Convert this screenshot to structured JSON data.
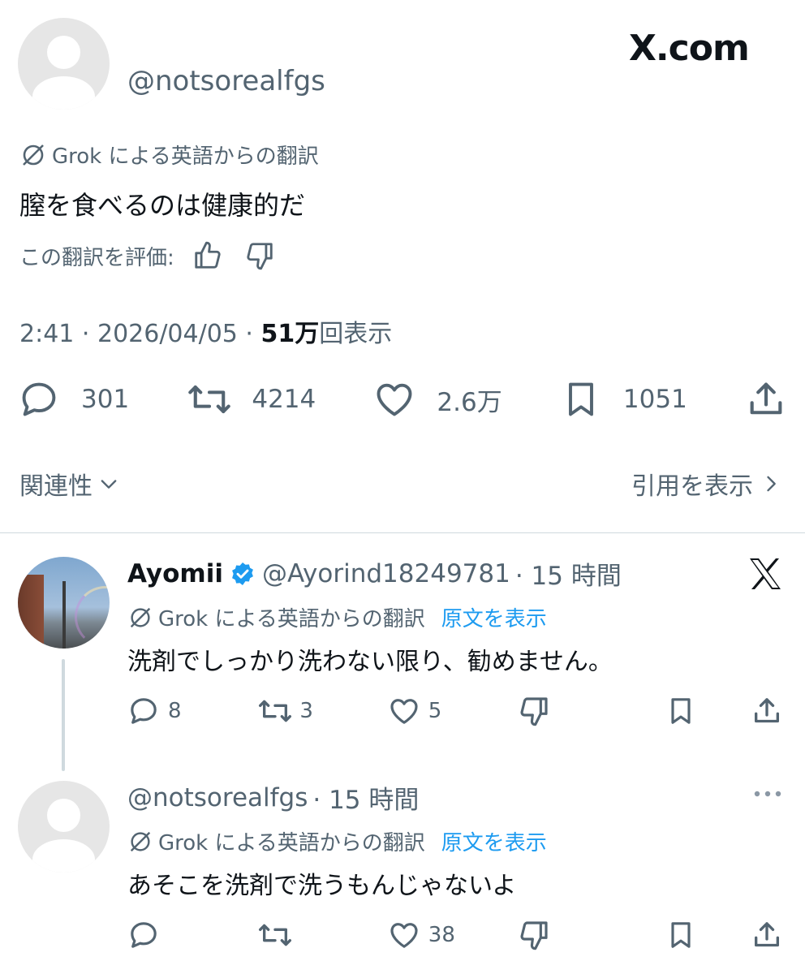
{
  "brand": {
    "logo_text": "X.com"
  },
  "main_post": {
    "handle": "@notsorealfgs",
    "translation_label": "Grok による英語からの翻訳",
    "text": "膣を食べるのは健康的だ",
    "rate_label": "この翻訳を評価:",
    "time": "2:41 · 2026/04/05 · ",
    "views_number": "51万",
    "views_suffix": "回表示",
    "metrics": {
      "replies": "301",
      "reposts": "4214",
      "likes": "2.6万",
      "bookmarks": "1051"
    },
    "sort_label": "関連性",
    "quotes_label": "引用を表示"
  },
  "replies": [
    {
      "name": "Ayomii",
      "handle": "@Ayorind18249781",
      "time": "· 15 時間",
      "translation_label": "Grok による英語からの翻訳",
      "show_original": "原文を表示",
      "text": "洗剤でしっかり洗わない限り、勧めません。",
      "replies": "8",
      "reposts": "3",
      "likes": "5"
    },
    {
      "handle": "@notsorealfgs",
      "time": "· 15 時間",
      "translation_label": "Grok による英語からの翻訳",
      "show_original": "原文を表示",
      "text": "あそこを洗剤で洗うもんじゃないよ",
      "replies": "",
      "reposts": "",
      "likes": "38"
    }
  ],
  "colors": {
    "text": "#0f1419",
    "secondary": "#536471",
    "accent": "#1d9bf0",
    "divider": "#cfd9de"
  }
}
